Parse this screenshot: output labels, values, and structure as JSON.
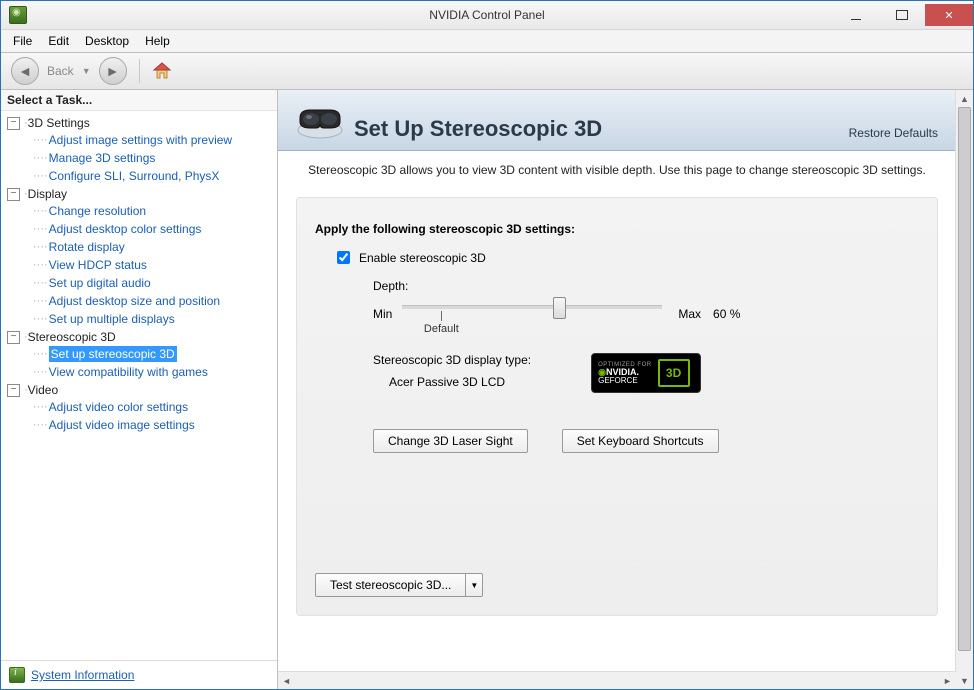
{
  "window": {
    "title": "NVIDIA Control Panel"
  },
  "menu": {
    "file": "File",
    "edit": "Edit",
    "desktop": "Desktop",
    "help": "Help"
  },
  "toolbar": {
    "back": "Back"
  },
  "sidebar": {
    "heading": "Select a Task...",
    "groups": [
      {
        "label": "3D Settings",
        "items": [
          "Adjust image settings with preview",
          "Manage 3D settings",
          "Configure SLI, Surround, PhysX"
        ]
      },
      {
        "label": "Display",
        "items": [
          "Change resolution",
          "Adjust desktop color settings",
          "Rotate display",
          "View HDCP status",
          "Set up digital audio",
          "Adjust desktop size and position",
          "Set up multiple displays"
        ]
      },
      {
        "label": "Stereoscopic 3D",
        "items": [
          "Set up stereoscopic 3D",
          "View compatibility with games"
        ],
        "selectedIndex": 0
      },
      {
        "label": "Video",
        "items": [
          "Adjust video color settings",
          "Adjust video image settings"
        ]
      }
    ],
    "system_info": "System Information"
  },
  "page": {
    "title": "Set Up Stereoscopic 3D",
    "restore": "Restore Defaults",
    "description": "Stereoscopic 3D allows you to view 3D content with visible depth. Use this page to change stereoscopic 3D settings.",
    "section_title": "Apply the following stereoscopic 3D settings:",
    "enable_label": "Enable stereoscopic 3D",
    "depth_label": "Depth:",
    "depth_min": "Min",
    "depth_max": "Max",
    "depth_value": "60",
    "depth_unit": "%",
    "depth_default_label": "Default",
    "depth_default_percent": 15,
    "depth_percent": 60,
    "display_type_label": "Stereoscopic 3D display type:",
    "display_type_value": "Acer Passive 3D LCD",
    "badge": {
      "optimized": "OPTIMIZED FOR",
      "brand": "NVIDIA.",
      "sub": "GEFORCE",
      "cube": "3D"
    },
    "btn_laser": "Change 3D Laser Sight",
    "btn_shortcuts": "Set Keyboard Shortcuts",
    "btn_test": "Test stereoscopic 3D..."
  }
}
